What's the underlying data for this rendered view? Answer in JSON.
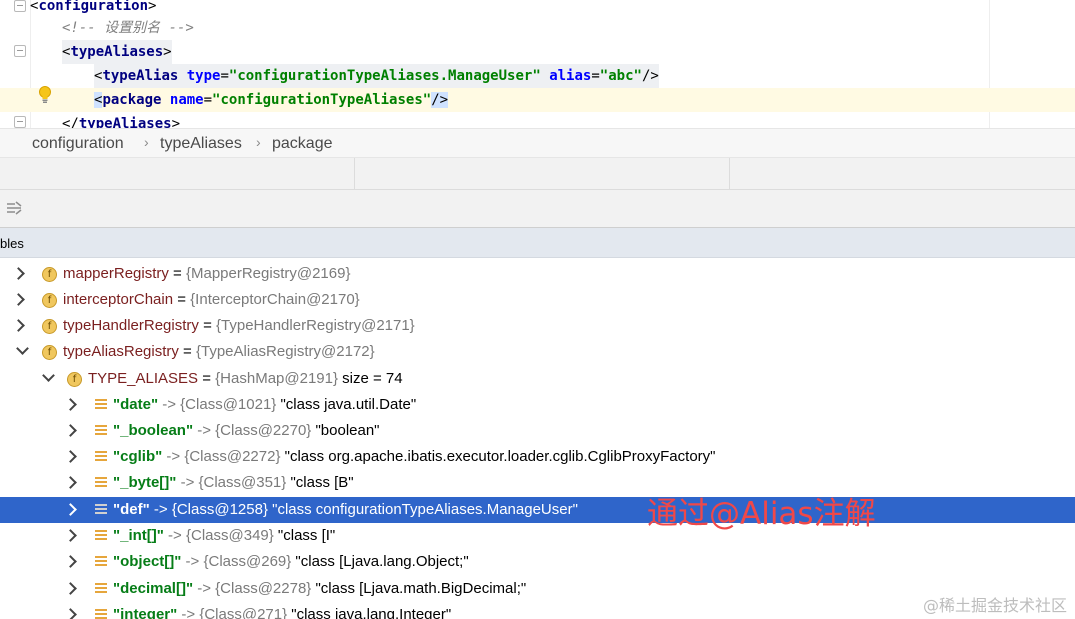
{
  "editor": {
    "lines": [
      {
        "tag_open": "<",
        "tag": "configuration",
        "tag_close": ">"
      },
      {
        "comment": "<!-- 设置别名 -->"
      },
      {
        "tag_open": "<",
        "tag": "typeAliases",
        "tag_close": ">"
      },
      {
        "tag_open": "<",
        "tag": "typeAlias",
        "attr1": "type",
        "eq": "=",
        "val1": "\"configurationTypeAliases.ManageUser\"",
        "attr2": "alias",
        "val2": "\"abc\"",
        "tag_close": "/>"
      },
      {
        "tag_open": "<",
        "tag": "package",
        "attr1": "name",
        "eq": "=",
        "val1": "\"configurationTypeAliases\"",
        "tag_close": "/>"
      },
      {
        "tag_open": "</",
        "tag": "typeAliases",
        "tag_close": ">"
      }
    ]
  },
  "breadcrumb": [
    "configuration",
    "typeAliases",
    "package"
  ],
  "breadcrumb_sep": "›",
  "variables_title": "bles",
  "tree": {
    "rows": [
      {
        "name": "mapperRegistry",
        "sep": " = ",
        "value": "{MapperRegistry@2169}"
      },
      {
        "name": "interceptorChain",
        "sep": " = ",
        "value": "{InterceptorChain@2170}"
      },
      {
        "name": "typeHandlerRegistry",
        "sep": " = ",
        "value": "{TypeHandlerRegistry@2171}"
      },
      {
        "name": "typeAliasRegistry",
        "sep": " = ",
        "value": "{TypeAliasRegistry@2172}"
      },
      {
        "name": "TYPE_ALIASES",
        "sep": " = ",
        "value": "{HashMap@2191}",
        "extra": " size = 74"
      }
    ],
    "entries": [
      {
        "key": "\"date\"",
        "arrow": " -> ",
        "cls": "{Class@1021}",
        "val": " \"class java.util.Date\""
      },
      {
        "key": "\"_boolean\"",
        "arrow": " -> ",
        "cls": "{Class@2270}",
        "val": " \"boolean\""
      },
      {
        "key": "\"cglib\"",
        "arrow": " -> ",
        "cls": "{Class@2272}",
        "val": " \"class org.apache.ibatis.executor.loader.cglib.CglibProxyFactory\""
      },
      {
        "key": "\"_byte[]\"",
        "arrow": " -> ",
        "cls": "{Class@351}",
        "val": " \"class [B\""
      },
      {
        "key": "\"def\"",
        "arrow": " -> ",
        "cls": "{Class@1258}",
        "val": " \"class configurationTypeAliases.ManageUser\""
      },
      {
        "key": "\"_int[]\"",
        "arrow": " -> ",
        "cls": "{Class@349}",
        "val": " \"class [I\""
      },
      {
        "key": "\"object[]\"",
        "arrow": " -> ",
        "cls": "{Class@269}",
        "val": " \"class [Ljava.lang.Object;\""
      },
      {
        "key": "\"decimal[]\"",
        "arrow": " -> ",
        "cls": "{Class@2278}",
        "val": " \"class [Ljava.math.BigDecimal;\""
      },
      {
        "key": "\"integer\"",
        "arrow": " -> ",
        "cls": "{Class@271}",
        "val": " \"class java.lang.Integer\""
      }
    ],
    "field_icon_letter": "f"
  },
  "annotation": "通过@Alias注解",
  "watermark": "@稀土掘金技术社区",
  "colors": {
    "selection": "#2f65ca",
    "annotation": "#f04848",
    "key": "#067d17"
  }
}
